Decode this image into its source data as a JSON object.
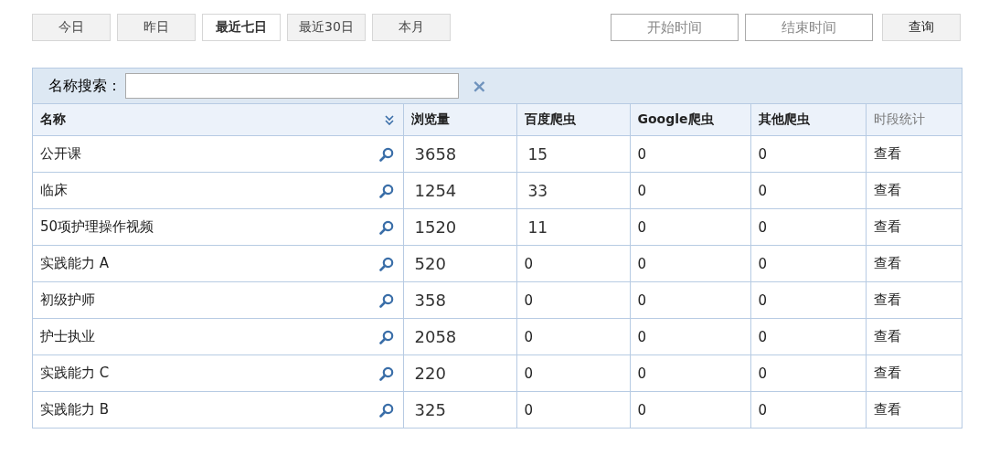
{
  "presets": [
    {
      "label": "今日",
      "selected": false
    },
    {
      "label": "昨日",
      "selected": false
    },
    {
      "label": "最近七日",
      "selected": true
    },
    {
      "label": "最近30日",
      "selected": false
    },
    {
      "label": "本月",
      "selected": false
    }
  ],
  "date_range": {
    "start_placeholder": "开始时间",
    "end_placeholder": "结束时间",
    "query_button": "查询"
  },
  "search": {
    "label": "名称搜索：",
    "clear": "×"
  },
  "table": {
    "columns": [
      "名称",
      "浏览量",
      "百度爬虫",
      "Google爬虫",
      "其他爬虫",
      "时段统计"
    ],
    "rows": [
      {
        "name": "公开课",
        "views": "3658",
        "baidu": "15",
        "google": "0",
        "other": "0",
        "action": "查看"
      },
      {
        "name": "临床",
        "views": "1254",
        "baidu": "33",
        "google": "0",
        "other": "0",
        "action": "查看"
      },
      {
        "name": "50项护理操作视频",
        "views": "1520",
        "baidu": "11",
        "google": "0",
        "other": "0",
        "action": "查看"
      },
      {
        "name": "实践能力 A",
        "views": "520",
        "baidu": "0",
        "google": "0",
        "other": "0",
        "action": "查看"
      },
      {
        "name": "初级护师",
        "views": "358",
        "baidu": "0",
        "google": "0",
        "other": "0",
        "action": "查看"
      },
      {
        "name": "护士执业",
        "views": "2058",
        "baidu": "0",
        "google": "0",
        "other": "0",
        "action": "查看"
      },
      {
        "name": "实践能力 C",
        "views": "220",
        "baidu": "0",
        "google": "0",
        "other": "0",
        "action": "查看"
      },
      {
        "name": "实践能力 B",
        "views": "325",
        "baidu": "0",
        "google": "0",
        "other": "0",
        "action": "查看"
      }
    ]
  }
}
